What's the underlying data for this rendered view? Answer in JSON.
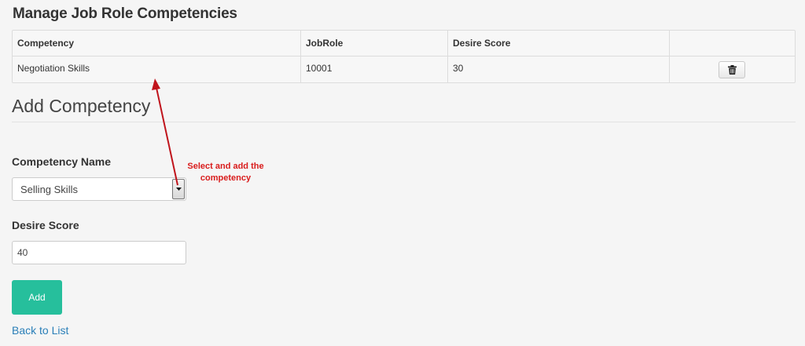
{
  "page": {
    "title": "Manage Job Role Competencies"
  },
  "table": {
    "headers": [
      "Competency",
      "JobRole",
      "Desire Score",
      ""
    ],
    "rows": [
      {
        "competency": "Negotiation Skills",
        "job_role": "10001",
        "desire_score": "30",
        "action_icon": "trash-icon"
      }
    ]
  },
  "form": {
    "section_title": "Add Competency",
    "competency_label": "Competency Name",
    "competency_selected": "Selling Skills",
    "score_label": "Desire Score",
    "score_value": "40",
    "add_label": "Add",
    "back_link": "Back to List"
  },
  "annotation": {
    "text_line1": "Select and add the",
    "text_line2": "competency",
    "color": "#d91c1c"
  },
  "colors": {
    "accent": "#26bf9c",
    "link": "#2a7fb8"
  }
}
